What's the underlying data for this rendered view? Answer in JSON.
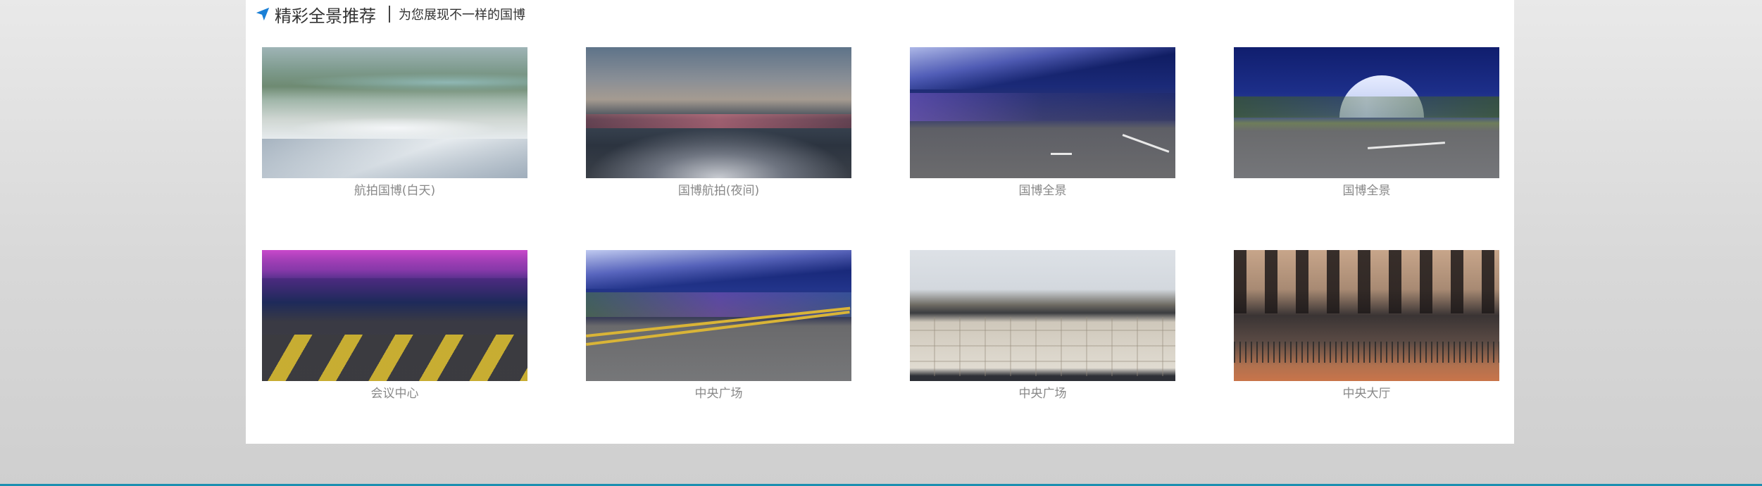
{
  "section": {
    "title": "精彩全景推荐",
    "subtitle": "为您展现不一样的国博",
    "icon": "navigation-arrow-icon",
    "accent_color": "#1a7fd6"
  },
  "panoramas": [
    {
      "caption": "航拍国博(白天)"
    },
    {
      "caption": "国博航拍(夜间)"
    },
    {
      "caption": "国博全景"
    },
    {
      "caption": "国博全景"
    },
    {
      "caption": "会议中心"
    },
    {
      "caption": "中央广场"
    },
    {
      "caption": "中央广场"
    },
    {
      "caption": "中央大厅"
    }
  ]
}
